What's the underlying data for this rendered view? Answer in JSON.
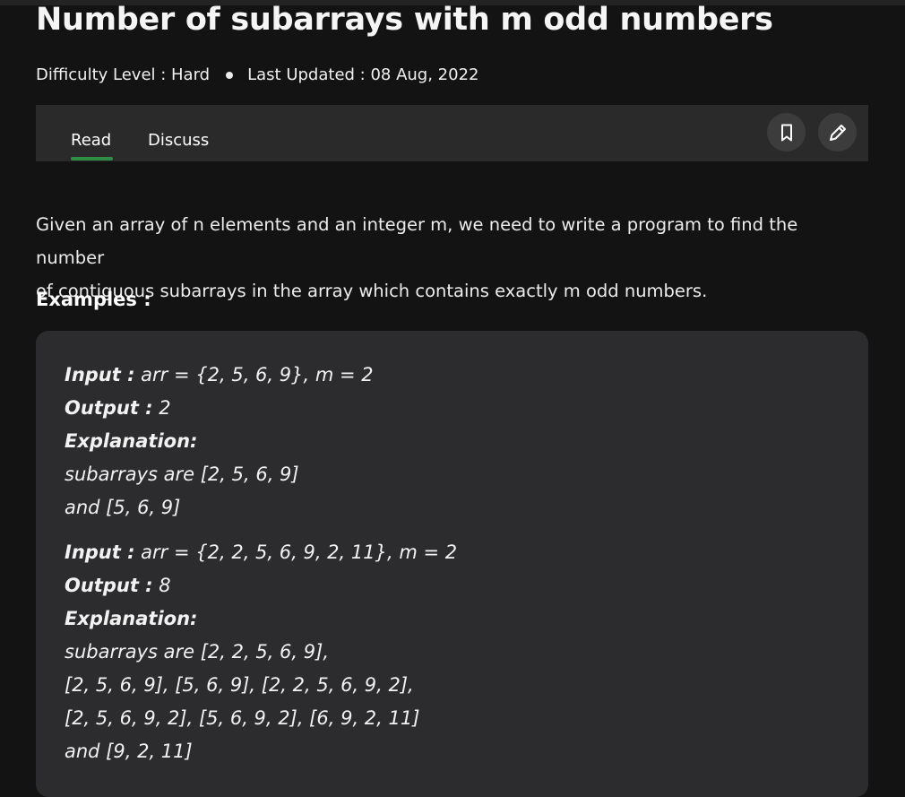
{
  "article": {
    "title": "Number of subarrays with m odd numbers",
    "difficulty": "Difficulty Level : Hard",
    "updated": "Last Updated : 08 Aug, 2022"
  },
  "tabs": {
    "read": "Read",
    "discuss": "Discuss"
  },
  "icons": {
    "bookmark": "bookmark-icon",
    "edit": "pencil-icon"
  },
  "content": {
    "paragraph_line1": "Given an array of n elements and an integer m, we need to write a program to find the number",
    "paragraph_line2": "of contiguous subarrays in the array which contains exactly m odd numbers.",
    "examples_heading": "Examples :"
  },
  "examples": [
    {
      "input_label": "Input :",
      "input_value": " arr = {2, 5, 6, 9},  m = 2",
      "output_label": "Output :",
      "output_value": " 2",
      "explanation_label": "Explanation:",
      "explanation_lines": [
        "subarrays are [2, 5, 6, 9]",
        "and [5, 6, 9]"
      ]
    },
    {
      "input_label": "Input :",
      "input_value": " arr = {2, 2, 5, 6, 9, 2, 11},  m = 2",
      "output_label": "Output :",
      "output_value": " 8",
      "explanation_label": "Explanation:",
      "explanation_lines": [
        "subarrays are [2, 2, 5, 6, 9],",
        "[2, 5, 6, 9], [5, 6, 9], [2, 2, 5, 6, 9, 2],",
        "[2, 5, 6, 9, 2], [5, 6, 9, 2], [6, 9, 2, 11]",
        "and [9, 2, 11]"
      ]
    }
  ],
  "colors": {
    "background": "#131313",
    "panel": "#2a2a2a",
    "code_box": "#2c2c2e",
    "accent": "#2f8d46"
  }
}
